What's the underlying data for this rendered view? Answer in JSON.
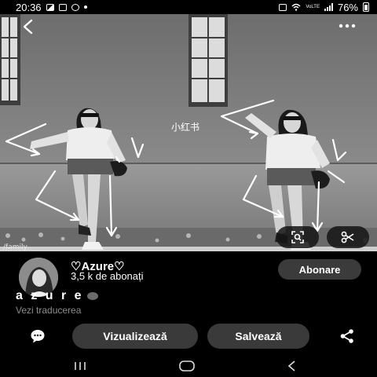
{
  "status_bar": {
    "time": "20:36",
    "network_label": "VoLTE",
    "battery_percent": "76%"
  },
  "photo": {
    "watermark": "小红书",
    "source_label": "/family"
  },
  "author": {
    "name": "♡Azure♡",
    "subscribers": "3,5 k de abonați",
    "follow_label": "Abonare"
  },
  "pin": {
    "title": "a z u r e",
    "translate_label": "Vezi traducerea"
  },
  "actions": {
    "view_label": "Vizualizează",
    "save_label": "Salvează"
  },
  "icons": {
    "back": "back-arrow-icon",
    "more": "more-dots-icon",
    "lens": "visual-search-icon",
    "scissors": "scissors-icon",
    "comment": "comment-icon",
    "share": "share-icon"
  },
  "colors": {
    "background": "#000000",
    "button": "#3a3a3a",
    "muted_text": "#8b8b8b"
  }
}
